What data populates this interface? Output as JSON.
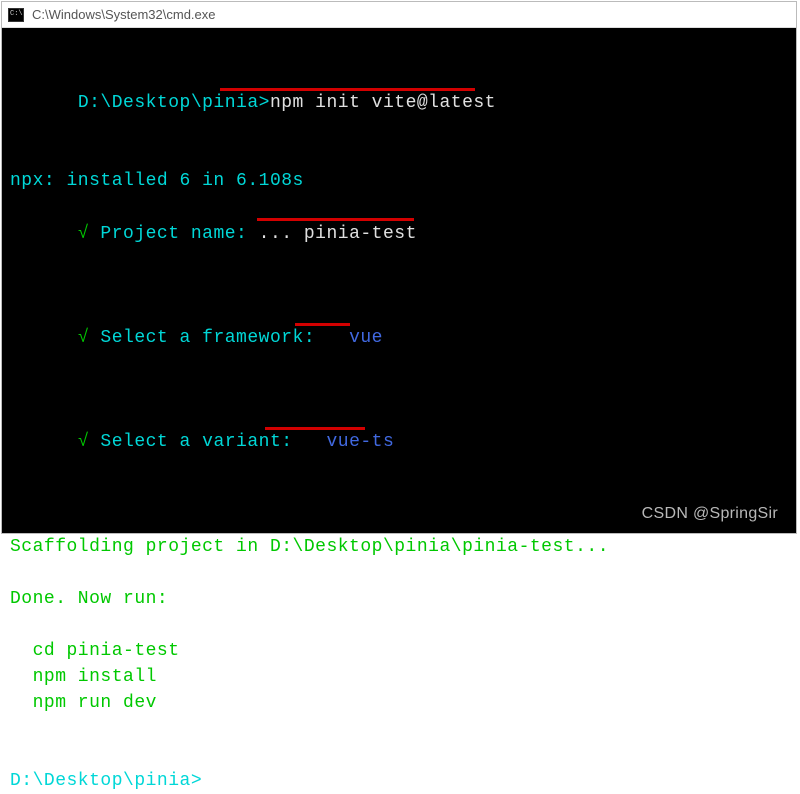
{
  "titlebar": {
    "path": "C:\\Windows\\System32\\cmd.exe"
  },
  "prompt1": {
    "cwd": "D:\\Desktop\\pinia>",
    "command": "npm init vite@latest"
  },
  "npx_line": "npx: installed 6 in 6.108s",
  "q1": {
    "check": "√",
    "label": " Project name:",
    "dots": " ... ",
    "value": "pinia-test"
  },
  "q2": {
    "check": "√",
    "label": " Select a framework:",
    "spacer": "   ",
    "value": "vue"
  },
  "q3": {
    "check": "√",
    "label": " Select a variant:",
    "spacer": "   ",
    "value": "vue-ts"
  },
  "scaffold": "Scaffolding project in D:\\Desktop\\pinia\\pinia-test...",
  "done": "Done. Now run:",
  "cmds": {
    "cd": "  cd pinia-test",
    "install": "  npm install",
    "dev": "  npm run dev"
  },
  "prompt2": {
    "cwd": "D:\\Desktop\\pinia>"
  },
  "watermark": "CSDN @SpringSir"
}
